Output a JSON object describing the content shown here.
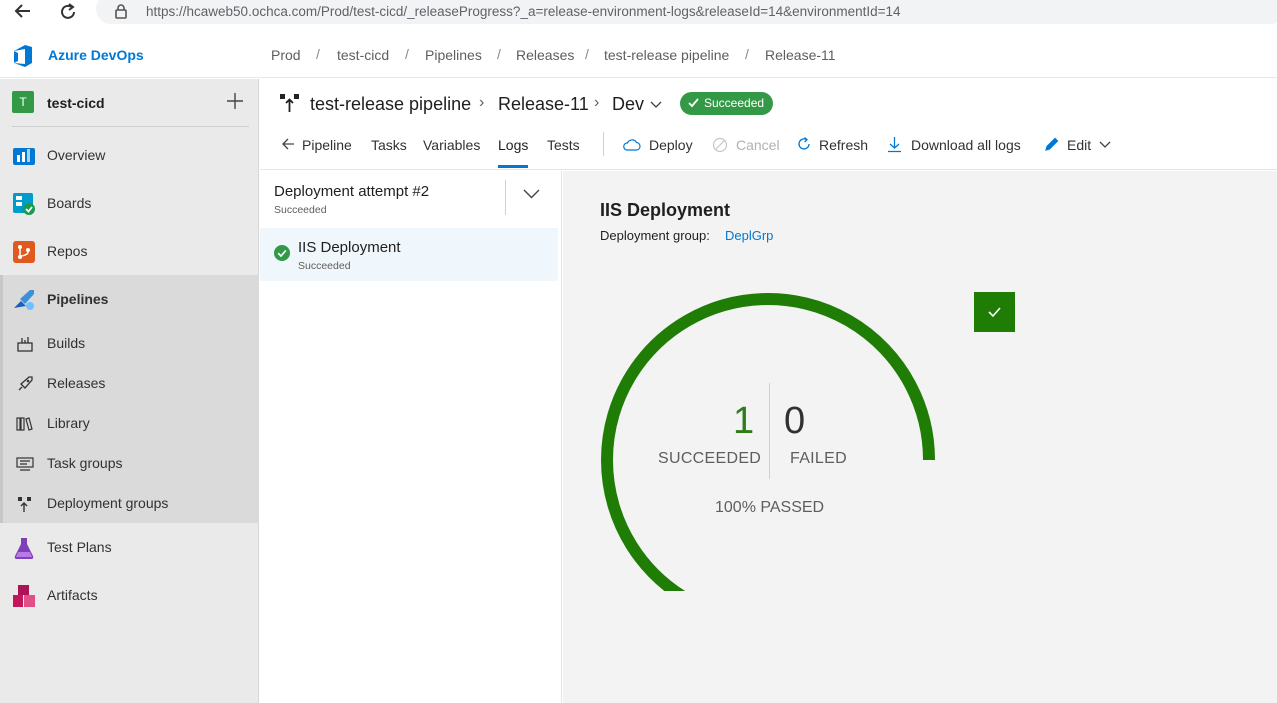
{
  "browser": {
    "url": "https://hcaweb50.ochca.com/Prod/test-cicd/_releaseProgress?_a=release-environment-logs&releaseId=14&environmentId=14",
    "icons": [
      "back-arrow-icon",
      "reload-icon",
      "lock-icon"
    ]
  },
  "header": {
    "brand": "Azure DevOps",
    "breadcrumbs": [
      "Prod",
      "test-cicd",
      "Pipelines",
      "Releases",
      "test-release pipeline",
      "Release-11"
    ],
    "separator": "/"
  },
  "sidebar": {
    "project_initial": "T",
    "project_name": "test-cicd",
    "items": [
      {
        "label": "Overview",
        "icon": "overview-icon"
      },
      {
        "label": "Boards",
        "icon": "boards-icon"
      },
      {
        "label": "Repos",
        "icon": "repos-icon"
      },
      {
        "label": "Pipelines",
        "icon": "pipelines-icon"
      },
      {
        "label": "Test Plans",
        "icon": "test-plans-icon"
      },
      {
        "label": "Artifacts",
        "icon": "artifacts-icon"
      }
    ],
    "pipelines_sub": [
      {
        "label": "Builds",
        "icon": "builds-icon"
      },
      {
        "label": "Releases",
        "icon": "releases-icon"
      },
      {
        "label": "Library",
        "icon": "library-icon"
      },
      {
        "label": "Task groups",
        "icon": "task-groups-icon"
      },
      {
        "label": "Deployment groups",
        "icon": "deployment-groups-icon"
      }
    ]
  },
  "title": {
    "pipeline": "test-release pipeline",
    "release": "Release-11",
    "stage": "Dev",
    "status": "Succeeded"
  },
  "tabs": {
    "pipeline": "Pipeline",
    "tasks": "Tasks",
    "variables": "Variables",
    "logs": "Logs",
    "tests": "Tests",
    "active": "Logs"
  },
  "commands": {
    "deploy": "Deploy",
    "cancel": "Cancel",
    "refresh": "Refresh",
    "download": "Download all logs",
    "edit": "Edit"
  },
  "list": {
    "attempt": "Deployment attempt #2",
    "attempt_status": "Succeeded",
    "job_name": "IIS Deployment",
    "job_status": "Succeeded"
  },
  "details": {
    "title": "IIS Deployment",
    "group_label": "Deployment group:",
    "group_link": "DeplGrp",
    "succeeded_count": "1",
    "succeeded_label": "SUCCEEDED",
    "failed_count": "0",
    "failed_label": "FAILED",
    "passed_label": "100% PASSED",
    "pass_fraction": 1.0
  },
  "colors": {
    "accent": "#0078d4",
    "success": "#339947",
    "gauge": "#1f7d06"
  }
}
